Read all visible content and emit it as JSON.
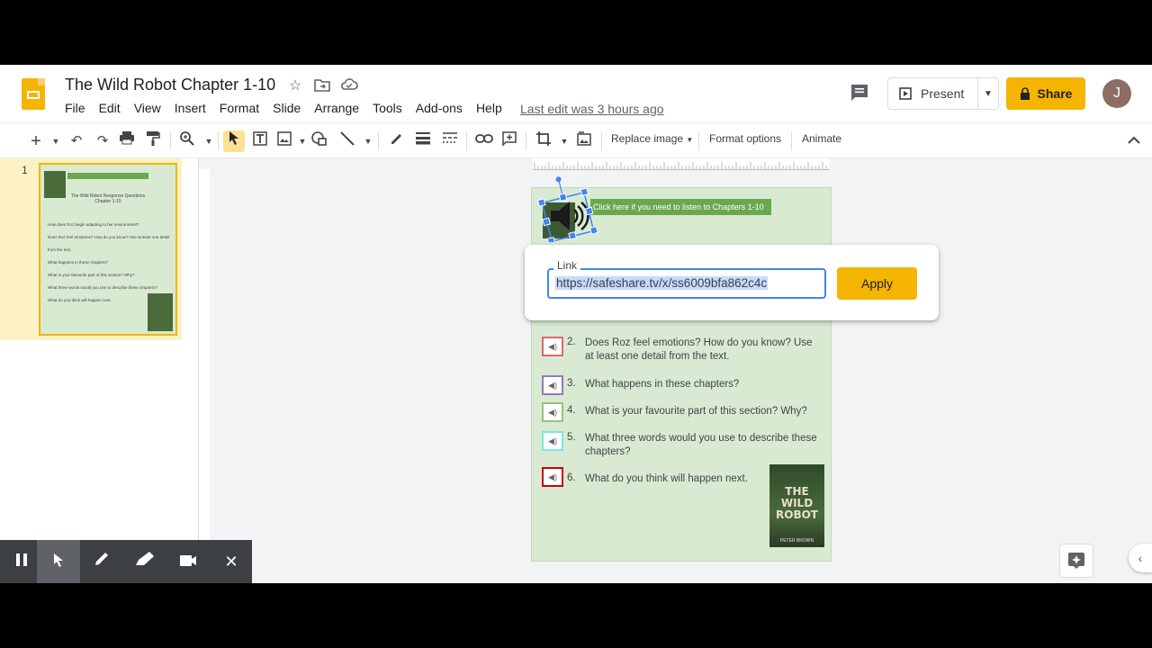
{
  "header": {
    "title": "The Wild Robot Chapter 1-10",
    "menu": [
      "File",
      "Edit",
      "View",
      "Insert",
      "Format",
      "Slide",
      "Arrange",
      "Tools",
      "Add-ons",
      "Help"
    ],
    "last_edit": "Last edit was 3 hours ago",
    "present_label": "Present",
    "share_label": "Share",
    "avatar_initial": "J"
  },
  "toolbar": {
    "replace_image": "Replace image",
    "format_options": "Format options",
    "animate": "Animate"
  },
  "filmstrip": {
    "slide_number": "1"
  },
  "slide": {
    "banner_text": "Click here if you need to listen to Chapters 1-10",
    "thumb_title": "The Wild Robot Response Questions Chapter 1-10",
    "questions": [
      {
        "num": "1.",
        "text": "How does Roz begin adapting to her environment?",
        "color": "#e06666"
      },
      {
        "num": "2.",
        "text": "Does Roz feel emotions? How do you know? Use at least one detail from the text.",
        "color": "#e06666"
      },
      {
        "num": "3.",
        "text": "What happens in these chapters?",
        "color": "#8e7cc3"
      },
      {
        "num": "4.",
        "text": "What is your favourite part of this section? Why?",
        "color": "#93c47d"
      },
      {
        "num": "5.",
        "text": "What three words would you use to describe these chapters?",
        "color": "#76e8e8"
      },
      {
        "num": "6.",
        "text": "What do you think will happen next.",
        "color": "#cc0000"
      }
    ],
    "book_title": "THE WILD ROBOT",
    "book_author": "PETER BROWN"
  },
  "link_popup": {
    "label": "Link",
    "value": "https://safeshare.tv/x/ss6009bfa862c4c",
    "apply_label": "Apply"
  }
}
